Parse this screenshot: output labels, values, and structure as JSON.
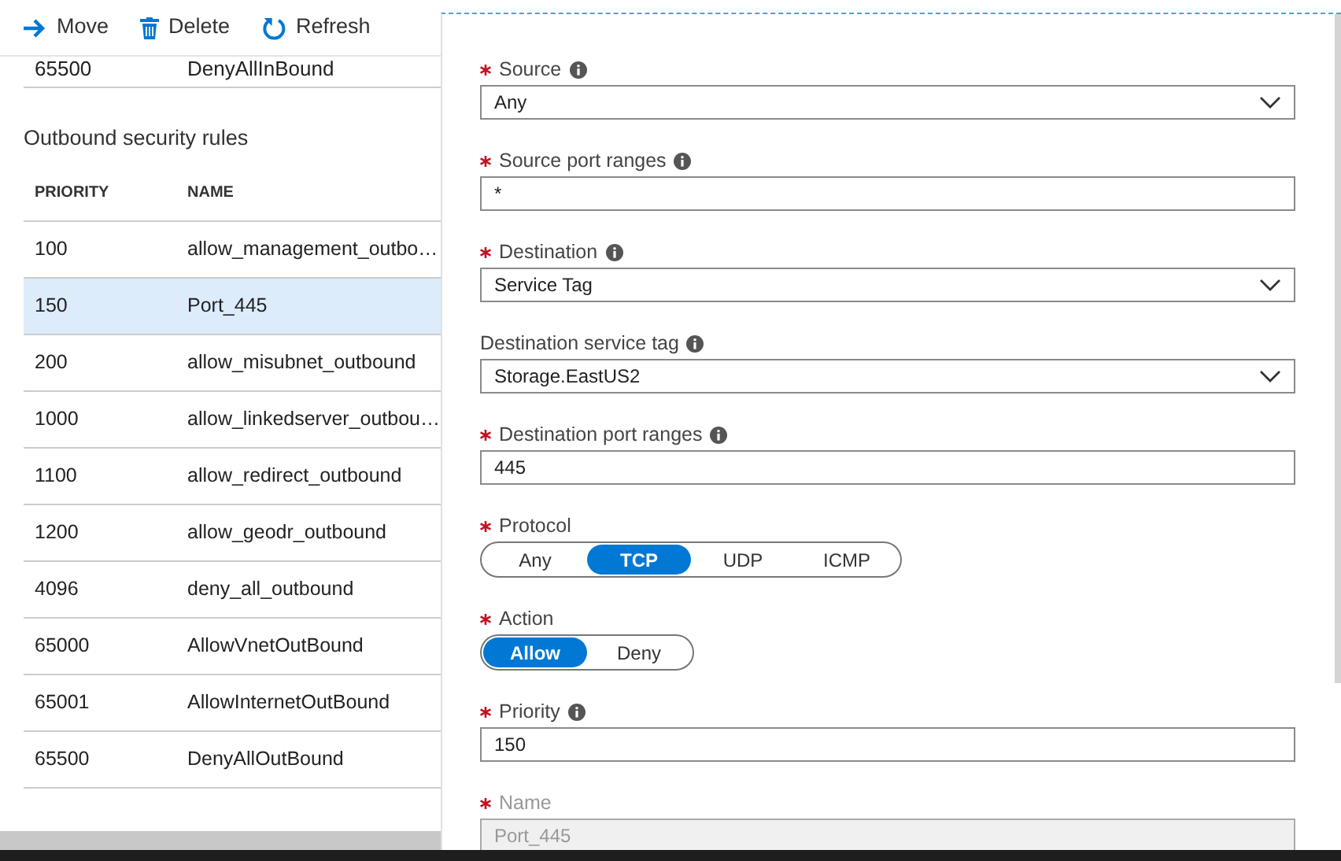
{
  "toolbar": [
    {
      "kind": "move",
      "label": "Move"
    },
    {
      "kind": "delete",
      "label": "Delete"
    },
    {
      "kind": "refresh",
      "label": "Refresh"
    }
  ],
  "inbound_last_row": {
    "priority": "65500",
    "name": "DenyAllInBound"
  },
  "outbound": {
    "title": "Outbound security rules",
    "columns": [
      "PRIORITY",
      "NAME"
    ],
    "rows": [
      {
        "priority": "100",
        "name": "allow_management_outbo…",
        "selected": false
      },
      {
        "priority": "150",
        "name": "Port_445",
        "selected": true
      },
      {
        "priority": "200",
        "name": "allow_misubnet_outbound",
        "selected": false
      },
      {
        "priority": "1000",
        "name": "allow_linkedserver_outbou…",
        "selected": false
      },
      {
        "priority": "1100",
        "name": "allow_redirect_outbound",
        "selected": false
      },
      {
        "priority": "1200",
        "name": "allow_geodr_outbound",
        "selected": false
      },
      {
        "priority": "4096",
        "name": "deny_all_outbound",
        "selected": false
      },
      {
        "priority": "65000",
        "name": "AllowVnetOutBound",
        "selected": false
      },
      {
        "priority": "65001",
        "name": "AllowInternetOutBound",
        "selected": false
      },
      {
        "priority": "65500",
        "name": "DenyAllOutBound",
        "selected": false
      }
    ]
  },
  "form": {
    "fields": [
      {
        "kind": "select",
        "label": "Source",
        "required": true,
        "info": true,
        "value": "Any"
      },
      {
        "kind": "text",
        "label": "Source port ranges",
        "required": true,
        "info": true,
        "value": "*"
      },
      {
        "kind": "select",
        "label": "Destination",
        "required": true,
        "info": true,
        "value": "Service Tag"
      },
      {
        "kind": "select",
        "label": "Destination service tag",
        "required": false,
        "info": true,
        "value": "Storage.EastUS2"
      },
      {
        "kind": "text",
        "label": "Destination port ranges",
        "required": true,
        "info": true,
        "value": "445"
      },
      {
        "kind": "segmented",
        "label": "Protocol",
        "required": true,
        "info": false,
        "options": [
          {
            "label": "Any",
            "selected": false
          },
          {
            "label": "TCP",
            "selected": true
          },
          {
            "label": "UDP",
            "selected": false
          },
          {
            "label": "ICMP",
            "selected": false
          }
        ]
      },
      {
        "kind": "segmented",
        "label": "Action",
        "required": true,
        "info": false,
        "options": [
          {
            "label": "Allow",
            "selected": true
          },
          {
            "label": "Deny",
            "selected": false
          }
        ]
      },
      {
        "kind": "text",
        "label": "Priority",
        "required": true,
        "info": true,
        "value": "150"
      },
      {
        "kind": "text",
        "label": "Name",
        "required": true,
        "info": false,
        "disabled": true,
        "value": "Port_445"
      }
    ]
  }
}
